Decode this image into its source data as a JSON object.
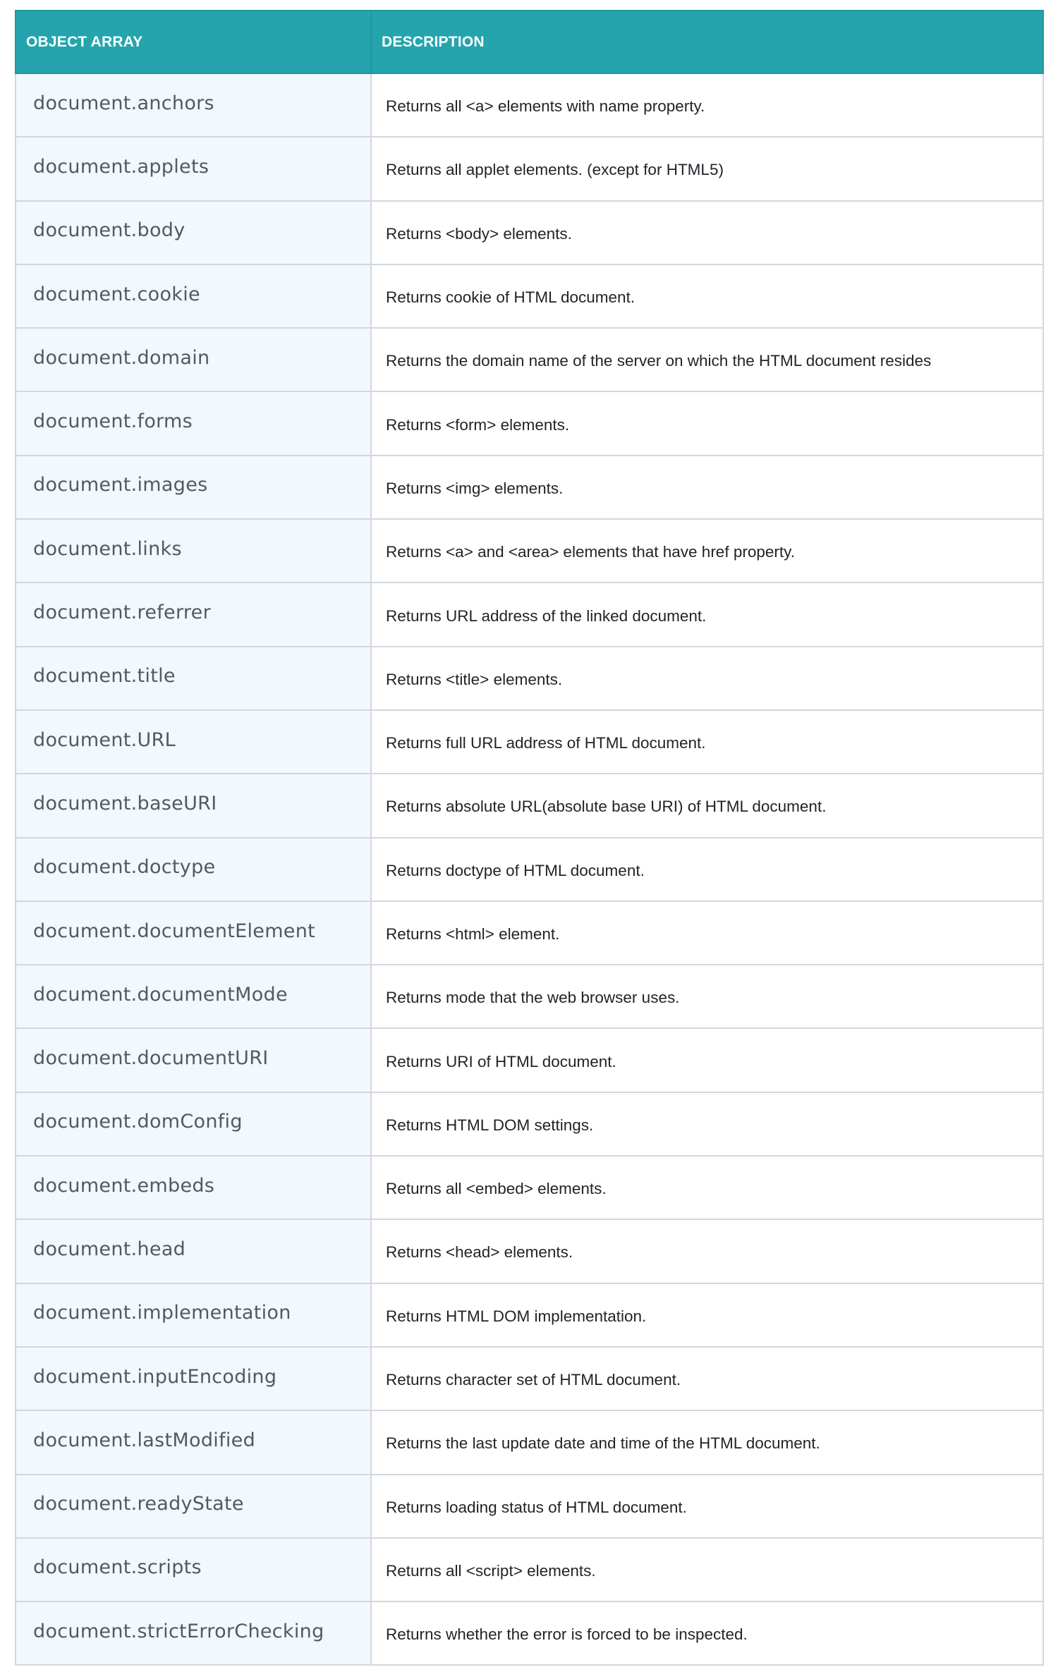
{
  "table": {
    "headers": [
      "OBJECT ARRAY",
      "DESCRIPTION"
    ],
    "rows": [
      {
        "object": "document.anchors",
        "description": "Returns all <a> elements with name property."
      },
      {
        "object": "document.applets",
        "description": "Returns all applet elements. (except for HTML5)"
      },
      {
        "object": "document.body",
        "description": "Returns <body> elements."
      },
      {
        "object": "document.cookie",
        "description": "Returns cookie of HTML document."
      },
      {
        "object": "document.domain",
        "description": "Returns the domain name of the server on which the HTML document resides"
      },
      {
        "object": "document.forms",
        "description": "Returns <form> elements."
      },
      {
        "object": "document.images",
        "description": "Returns <img> elements."
      },
      {
        "object": "document.links",
        "description": "Returns <a> and <area> elements that have href property."
      },
      {
        "object": "document.referrer",
        "description": "Returns URL address of the linked document."
      },
      {
        "object": "document.title",
        "description": "Returns <title> elements."
      },
      {
        "object": "document.URL",
        "description": "Returns full URL address of HTML document."
      },
      {
        "object": "document.baseURI",
        "description": "Returns absolute URL(absolute base URI) of HTML document."
      },
      {
        "object": "document.doctype",
        "description": "Returns doctype of HTML document."
      },
      {
        "object": "document.documentElement",
        "description": "Returns <html> element."
      },
      {
        "object": "document.documentMode",
        "description": "Returns mode that the web browser uses."
      },
      {
        "object": "document.documentURI",
        "description": "Returns URI of HTML document."
      },
      {
        "object": "document.domConfig",
        "description": "Returns HTML DOM settings."
      },
      {
        "object": "document.embeds",
        "description": "Returns all <embed> elements."
      },
      {
        "object": "document.head",
        "description": "Returns <head> elements."
      },
      {
        "object": "document.implementation",
        "description": "Returns HTML DOM implementation."
      },
      {
        "object": "document.inputEncoding",
        "description": "Returns character set of HTML document."
      },
      {
        "object": "document.lastModified",
        "description": "Returns the last update date and time of the HTML document."
      },
      {
        "object": "document.readyState",
        "description": "Returns loading status of HTML document."
      },
      {
        "object": "document.scripts",
        "description": "Returns all <script> elements."
      },
      {
        "object": "document.strictErrorChecking",
        "description": "Returns whether the error is forced to be inspected."
      }
    ]
  }
}
